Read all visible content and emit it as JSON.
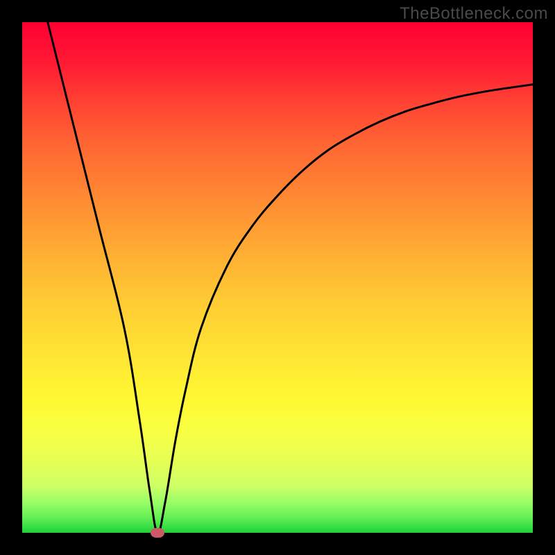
{
  "watermark": "TheBottleneck.com",
  "chart_data": {
    "type": "line",
    "title": "",
    "xlabel": "",
    "ylabel": "",
    "xlim": [
      0,
      100
    ],
    "ylim": [
      0,
      100
    ],
    "grid": false,
    "legend": false,
    "series": [
      {
        "name": "bottleneck-curve",
        "x": [
          5,
          10,
          15,
          20,
          23,
          25,
          26.5,
          28,
          30,
          32,
          35,
          40,
          45,
          50,
          55,
          60,
          65,
          70,
          75,
          80,
          85,
          90,
          95,
          100
        ],
        "y": [
          100,
          80,
          60,
          40,
          22,
          8,
          0,
          6,
          18,
          28,
          40,
          52,
          60,
          66,
          71,
          75,
          78,
          80.5,
          82.5,
          84,
          85.3,
          86.3,
          87.1,
          87.8
        ]
      }
    ],
    "marker": {
      "x": 26.5,
      "y": 0,
      "color": "#cc5964"
    },
    "background_gradient": {
      "top": "#ff0033",
      "mid": "#ffe433",
      "bottom": "#22cc33"
    }
  }
}
